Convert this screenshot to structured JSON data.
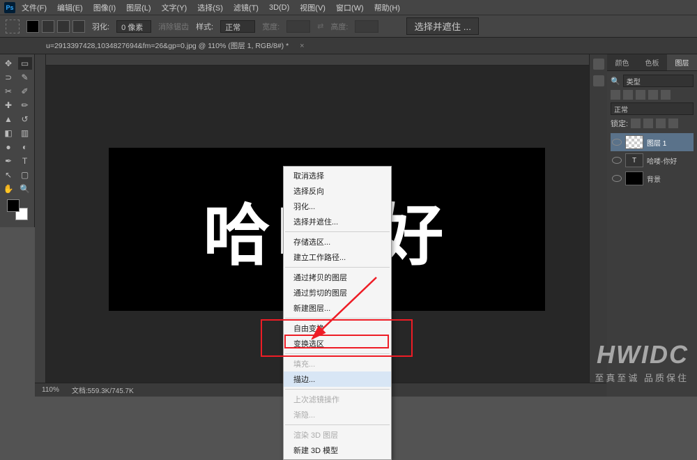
{
  "menubar": [
    "文件(F)",
    "编辑(E)",
    "图像(I)",
    "图层(L)",
    "文字(Y)",
    "选择(S)",
    "滤镜(T)",
    "3D(D)",
    "视图(V)",
    "窗口(W)",
    "帮助(H)"
  ],
  "options": {
    "feather_label": "羽化:",
    "feather_value": "0 像素",
    "antialias": "消除锯齿",
    "style_label": "样式:",
    "style_value": "正常",
    "width_label": "宽度:",
    "height_label": "高度:",
    "refine": "选择并遮住 ..."
  },
  "doc_tab": "u=2913397428,1034827694&fm=26&gp=0.jpg @ 110% (图层 1, RGB/8#) *",
  "canvas_text": "哈喽 好",
  "context_menu": [
    {
      "label": "取消选择",
      "dim": false
    },
    {
      "label": "选择反向",
      "dim": false
    },
    {
      "label": "羽化...",
      "dim": false
    },
    {
      "label": "选择并遮住...",
      "dim": false
    },
    {
      "sep": true
    },
    {
      "label": "存储选区...",
      "dim": false
    },
    {
      "label": "建立工作路径...",
      "dim": false
    },
    {
      "sep": true
    },
    {
      "label": "通过拷贝的图层",
      "dim": false
    },
    {
      "label": "通过剪切的图层",
      "dim": false
    },
    {
      "label": "新建图层...",
      "dim": false
    },
    {
      "sep": true
    },
    {
      "label": "自由变换",
      "dim": false
    },
    {
      "label": "变换选区",
      "dim": false
    },
    {
      "sep": true
    },
    {
      "label": "填充...",
      "dim": true
    },
    {
      "label": "描边...",
      "dim": false,
      "hl": true
    },
    {
      "sep": true
    },
    {
      "label": "上次滤镜操作",
      "dim": true
    },
    {
      "label": "渐隐...",
      "dim": true
    },
    {
      "sep": true
    },
    {
      "label": "渲染 3D 图层",
      "dim": true
    },
    {
      "label": "新建 3D 模型",
      "dim": false
    }
  ],
  "panel": {
    "tabs": [
      "颜色",
      "色板",
      "图层"
    ],
    "type_label": "类型",
    "blend": "正常",
    "lock_label": "锁定:",
    "layers": [
      {
        "name": "图层 1",
        "thumb": "check",
        "sel": true,
        "type": "raster"
      },
      {
        "name": "哈喽-你好",
        "thumb": "T",
        "type": "text"
      },
      {
        "name": "背景",
        "thumb": "black",
        "type": "bg"
      }
    ]
  },
  "status": {
    "zoom": "110%",
    "doc": "文档:559.3K/745.7K"
  },
  "watermark": {
    "big": "HWIDC",
    "small": "至真至诚  品质保住"
  },
  "icons": {
    "search": "🔍",
    "type": "T"
  }
}
